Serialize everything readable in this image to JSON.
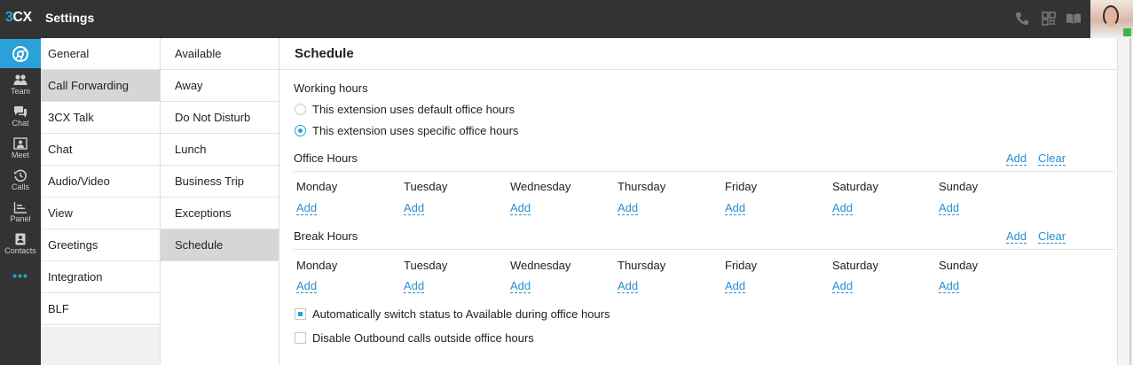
{
  "app": {
    "logo_num": "3",
    "logo_text": "CX",
    "title": "Settings"
  },
  "rail": {
    "items": [
      {
        "label": "",
        "icon": "chrome-icon"
      },
      {
        "label": "Team",
        "icon": "team-icon"
      },
      {
        "label": "Chat",
        "icon": "chat-icon"
      },
      {
        "label": "Meet",
        "icon": "meet-icon"
      },
      {
        "label": "Calls",
        "icon": "history-icon"
      },
      {
        "label": "Panel",
        "icon": "panel-icon"
      },
      {
        "label": "Contacts",
        "icon": "contacts-icon"
      }
    ],
    "more": "•••"
  },
  "settings_nav": {
    "items": [
      "General",
      "Call Forwarding",
      "3CX Talk",
      "Chat",
      "Audio/Video",
      "View",
      "Greetings",
      "Integration",
      "BLF"
    ],
    "active": "Call Forwarding"
  },
  "forwarding_nav": {
    "items": [
      "Available",
      "Away",
      "Do Not Disturb",
      "Lunch",
      "Business Trip",
      "Exceptions",
      "Schedule"
    ],
    "active": "Schedule"
  },
  "schedule": {
    "title": "Schedule",
    "working_hours_label": "Working hours",
    "option_default": "This extension uses default office hours",
    "option_specific": "This extension uses specific office hours",
    "selected_option": "specific",
    "office_hours_label": "Office Hours",
    "break_hours_label": "Break Hours",
    "add_label": "Add",
    "clear_label": "Clear",
    "days": [
      "Monday",
      "Tuesday",
      "Wednesday",
      "Thursday",
      "Friday",
      "Saturday",
      "Sunday"
    ],
    "auto_switch_label": "Automatically switch status to Available during office hours",
    "auto_switch_checked": true,
    "disable_outbound_label": "Disable Outbound calls outside office hours",
    "disable_outbound_checked": false
  },
  "colors": {
    "accent": "#2aa1d9",
    "link": "#2a8fd0",
    "dark_bar": "#333333",
    "active_item": "#d6d6d6",
    "presence": "#3fb449"
  }
}
